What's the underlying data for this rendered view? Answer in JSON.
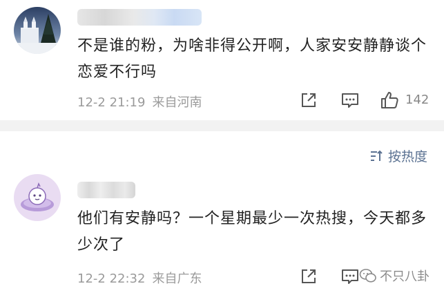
{
  "comments": [
    {
      "text": "不是谁的粉，为啥非得公开啊，人家安安静静谈个恋爱不行吗",
      "time": "12-2 21:19",
      "location": "来自河南",
      "like_count": "142"
    },
    {
      "text": "他们有安静吗？一个星期最少一次热搜，今天都多少次了",
      "time": "12-2 22:32",
      "location": "来自广东",
      "like_count": ""
    }
  ],
  "sort": {
    "label": "按热度"
  },
  "watermark": {
    "text": "不只八卦"
  },
  "colors": {
    "accent": "#5b7292",
    "meta": "#9a9a9a",
    "divider": "#f2f2f2"
  },
  "icons": [
    "share-icon",
    "comment-icon",
    "like-icon",
    "sort-icon",
    "wechat-icon"
  ]
}
